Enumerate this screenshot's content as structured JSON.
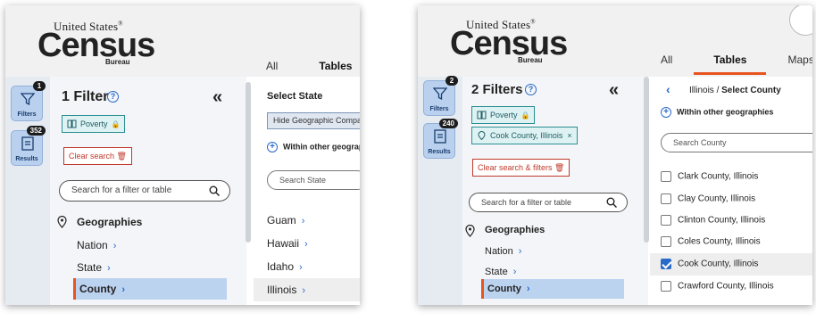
{
  "left": {
    "logo": {
      "line1": "United States",
      "reg": "®",
      "word": "Census",
      "line3": "Bureau"
    },
    "tabs": [
      {
        "label": "All"
      },
      {
        "label": "Tables"
      }
    ],
    "rail": {
      "filters": {
        "label": "Filters",
        "badge": "1"
      },
      "results": {
        "label": "Results",
        "badge": "352"
      }
    },
    "filter_panel": {
      "title": "1 Filter",
      "collapse": "«",
      "chips": [
        {
          "label": "Poverty"
        }
      ],
      "clear_label": "Clear search 🗑",
      "search_placeholder": "Search for a filter or table",
      "geo_heading": "Geographies",
      "geo_items": [
        {
          "label": "Nation"
        },
        {
          "label": "State"
        },
        {
          "label": "County"
        }
      ]
    },
    "select_panel": {
      "title": "Select State",
      "hide_label": "Hide Geographic Comparison",
      "within_label": "Within other geographies",
      "search_placeholder": "Search State",
      "states": [
        {
          "label": "Guam"
        },
        {
          "label": "Hawaii"
        },
        {
          "label": "Idaho"
        },
        {
          "label": "Illinois"
        }
      ]
    }
  },
  "right": {
    "logo": {
      "line1": "United States",
      "reg": "®",
      "word": "Census",
      "line3": "Bureau"
    },
    "tabs": [
      {
        "label": "All"
      },
      {
        "label": "Tables"
      },
      {
        "label": "Maps"
      }
    ],
    "rail": {
      "filters": {
        "label": "Filters",
        "badge": "2"
      },
      "results": {
        "label": "Results",
        "badge": "240"
      }
    },
    "filter_panel": {
      "title": "2 Filters",
      "collapse": "«",
      "chips": [
        {
          "label": "Poverty"
        },
        {
          "label": "Cook County, Illinois"
        }
      ],
      "clear_label": "Clear search & filters 🗑",
      "search_placeholder": "Search for a filter or table",
      "geo_heading": "Geographies",
      "geo_items": [
        {
          "label": "Nation"
        },
        {
          "label": "State"
        },
        {
          "label": "County"
        }
      ]
    },
    "select_panel": {
      "breadcrumb_parent": "Illinois / ",
      "breadcrumb_current": "Select County",
      "within_label": "Within other geographies",
      "search_placeholder": "Search County",
      "counties": [
        {
          "label": "Clark County, Illinois",
          "checked": false
        },
        {
          "label": "Clay County, Illinois",
          "checked": false
        },
        {
          "label": "Clinton County, Illinois",
          "checked": false
        },
        {
          "label": "Coles County, Illinois",
          "checked": false
        },
        {
          "label": "Cook County, Illinois",
          "checked": true
        },
        {
          "label": "Crawford County, Illinois",
          "checked": false
        }
      ]
    }
  },
  "colors": {
    "accent": "#e8541e",
    "link": "#2a6ac8",
    "chip_border": "#2b8f93",
    "selected_row": "#bcd3f0",
    "danger": "#c0392b"
  }
}
